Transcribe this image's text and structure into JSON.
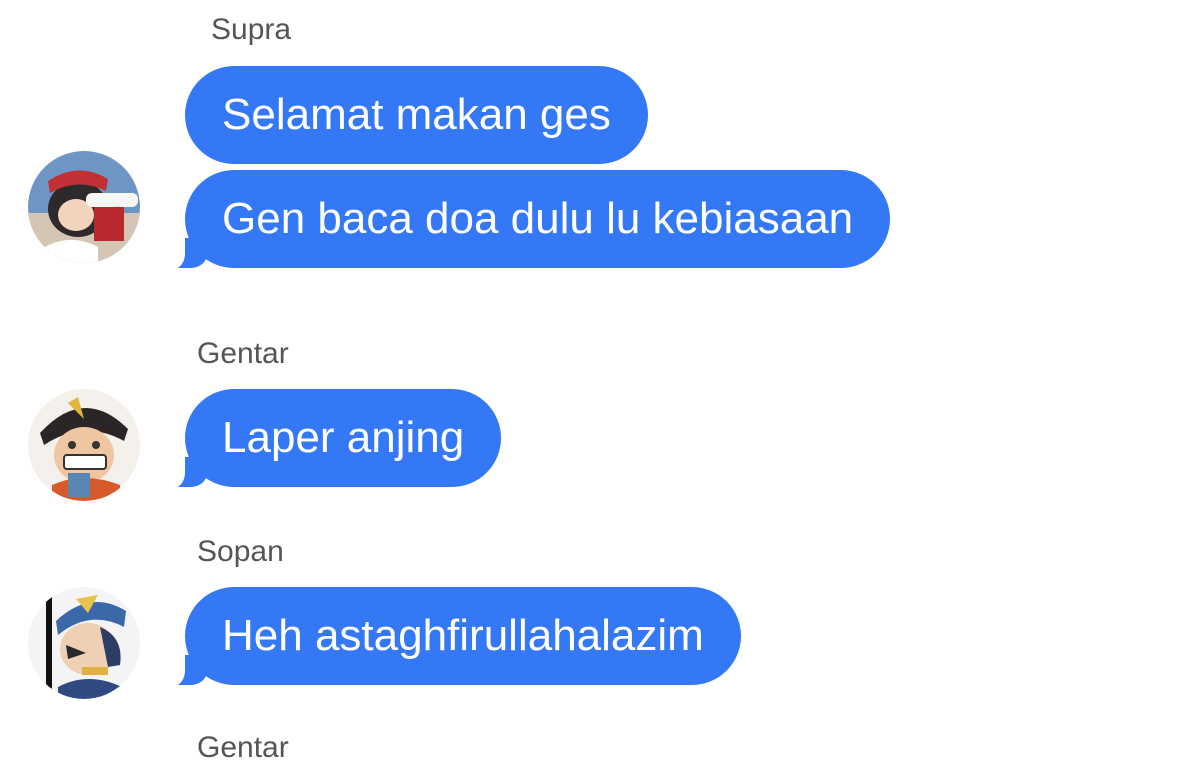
{
  "colors": {
    "bubble": "#3478f6",
    "bubble_text": "#ffffff",
    "sender_name": "#555555",
    "background": "#ffffff"
  },
  "messages": [
    {
      "sender": "Supra",
      "avatar_icon": "supra-avatar",
      "bubbles": [
        "Selamat makan ges",
        "Gen baca doa dulu lu kebiasaan"
      ]
    },
    {
      "sender": "Gentar",
      "avatar_icon": "gentar-avatar",
      "bubbles": [
        "Laper anjing"
      ]
    },
    {
      "sender": "Sopan",
      "avatar_icon": "sopan-avatar",
      "bubbles": [
        "Heh astaghfirullahalazim"
      ]
    },
    {
      "sender": "Gentar",
      "avatar_icon": "",
      "bubbles": []
    }
  ]
}
